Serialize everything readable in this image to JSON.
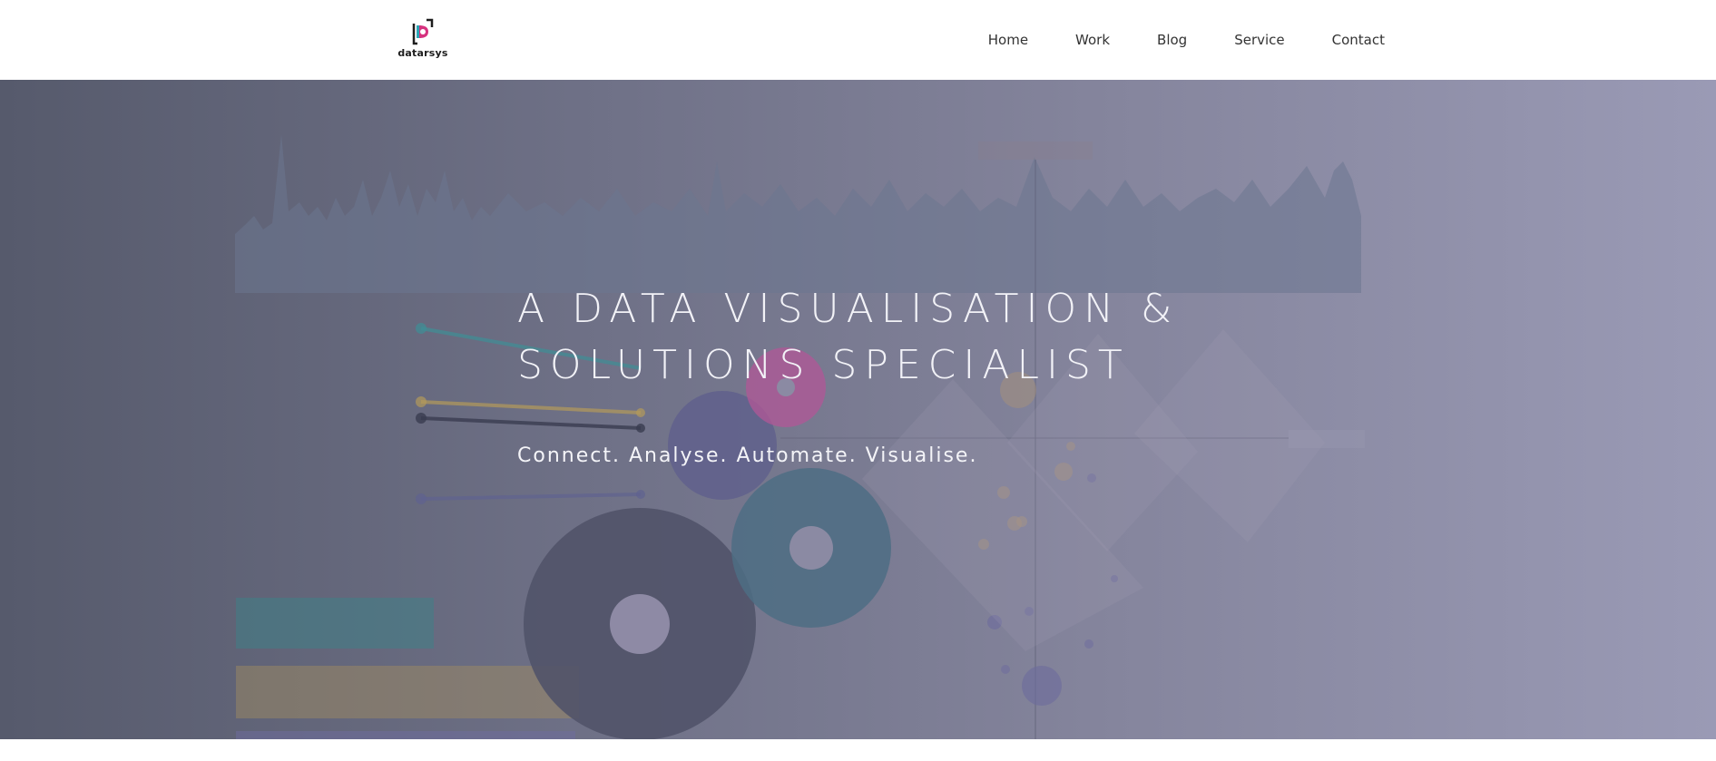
{
  "header": {
    "logo_text": "datarsys",
    "nav": [
      {
        "label": "Home"
      },
      {
        "label": "Work"
      },
      {
        "label": "Blog"
      },
      {
        "label": "Service"
      },
      {
        "label": "Contact"
      }
    ]
  },
  "hero": {
    "title_line1": "A DATA VISUALISATION &",
    "title_line2": "SOLUTIONS SPECIALIST",
    "tagline": "Connect. Analyse. Automate. Visualise.",
    "background_illustration": "data-visualisation-collage-icon"
  },
  "colors": {
    "hero_gradient_start": "#565a6c",
    "hero_gradient_end": "#9a9ab5",
    "logo_accent_pink": "#d6327f",
    "logo_accent_teal": "#2aa6b7"
  }
}
